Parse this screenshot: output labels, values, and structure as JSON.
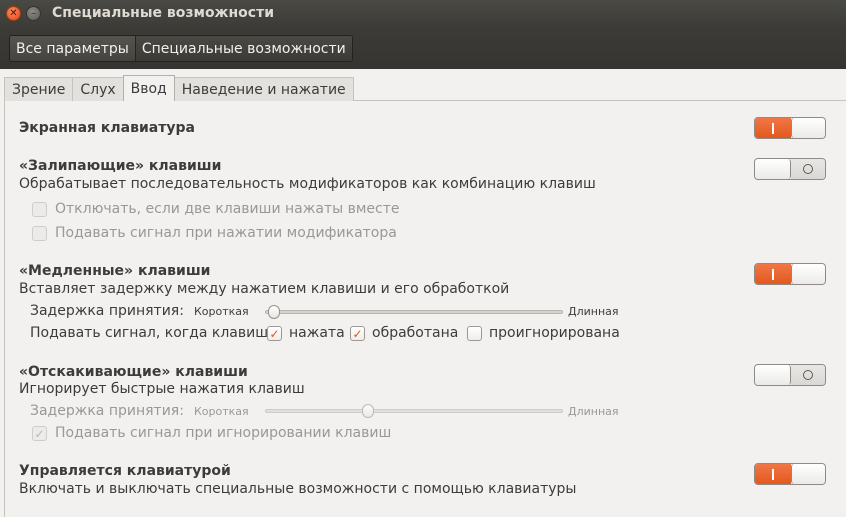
{
  "window": {
    "title": "Специальные возможности"
  },
  "breadcrumbs": [
    "Все параметры",
    "Специальные возможности"
  ],
  "tabs": [
    "Зрение",
    "Слух",
    "Ввод",
    "Наведение и нажатие"
  ],
  "active_tab": "Ввод",
  "accent_color": "#e4581e",
  "sections": {
    "onscreen_keyboard": {
      "title": "Экранная клавиатура",
      "enabled": true
    },
    "sticky_keys": {
      "title": "«Залипающие» клавиши",
      "description": "Обрабатывает последовательность модификаторов как комбинацию клавиш",
      "enabled": false,
      "options": [
        {
          "label": "Отключать, если две клавиши нажаты вместе",
          "checked": false
        },
        {
          "label": "Подавать сигнал при нажатии модификатора",
          "checked": false
        }
      ]
    },
    "slow_keys": {
      "title": "«Медленные» клавиши",
      "description": "Вставляет задержку между нажатием клавиши и его обработкой",
      "enabled": true,
      "delay_label": "Задержка принятия:",
      "slider_min_label": "Короткая",
      "slider_max_label": "Длинная",
      "slider_value": 0.01,
      "beep_label": "Подавать сигнал, когда клавиша",
      "beep_options": [
        {
          "label": "нажата",
          "checked": true
        },
        {
          "label": "обработана",
          "checked": true
        },
        {
          "label": "проигнорирована",
          "checked": false
        }
      ]
    },
    "bounce_keys": {
      "title": "«Отскакивающие» клавиши",
      "description": "Игнорирует быстрые нажатия клавиш",
      "enabled": false,
      "delay_label": "Задержка принятия:",
      "slider_min_label": "Короткая",
      "slider_max_label": "Длинная",
      "slider_value": 0.34,
      "beep_option": {
        "label": "Подавать сигнал при игнорировании клавиш",
        "checked": true
      }
    },
    "keyboard_control": {
      "title": "Управляется клавиатурой",
      "description": "Включать и выключать специальные возможности с помощью клавиатуры",
      "enabled": true
    }
  }
}
